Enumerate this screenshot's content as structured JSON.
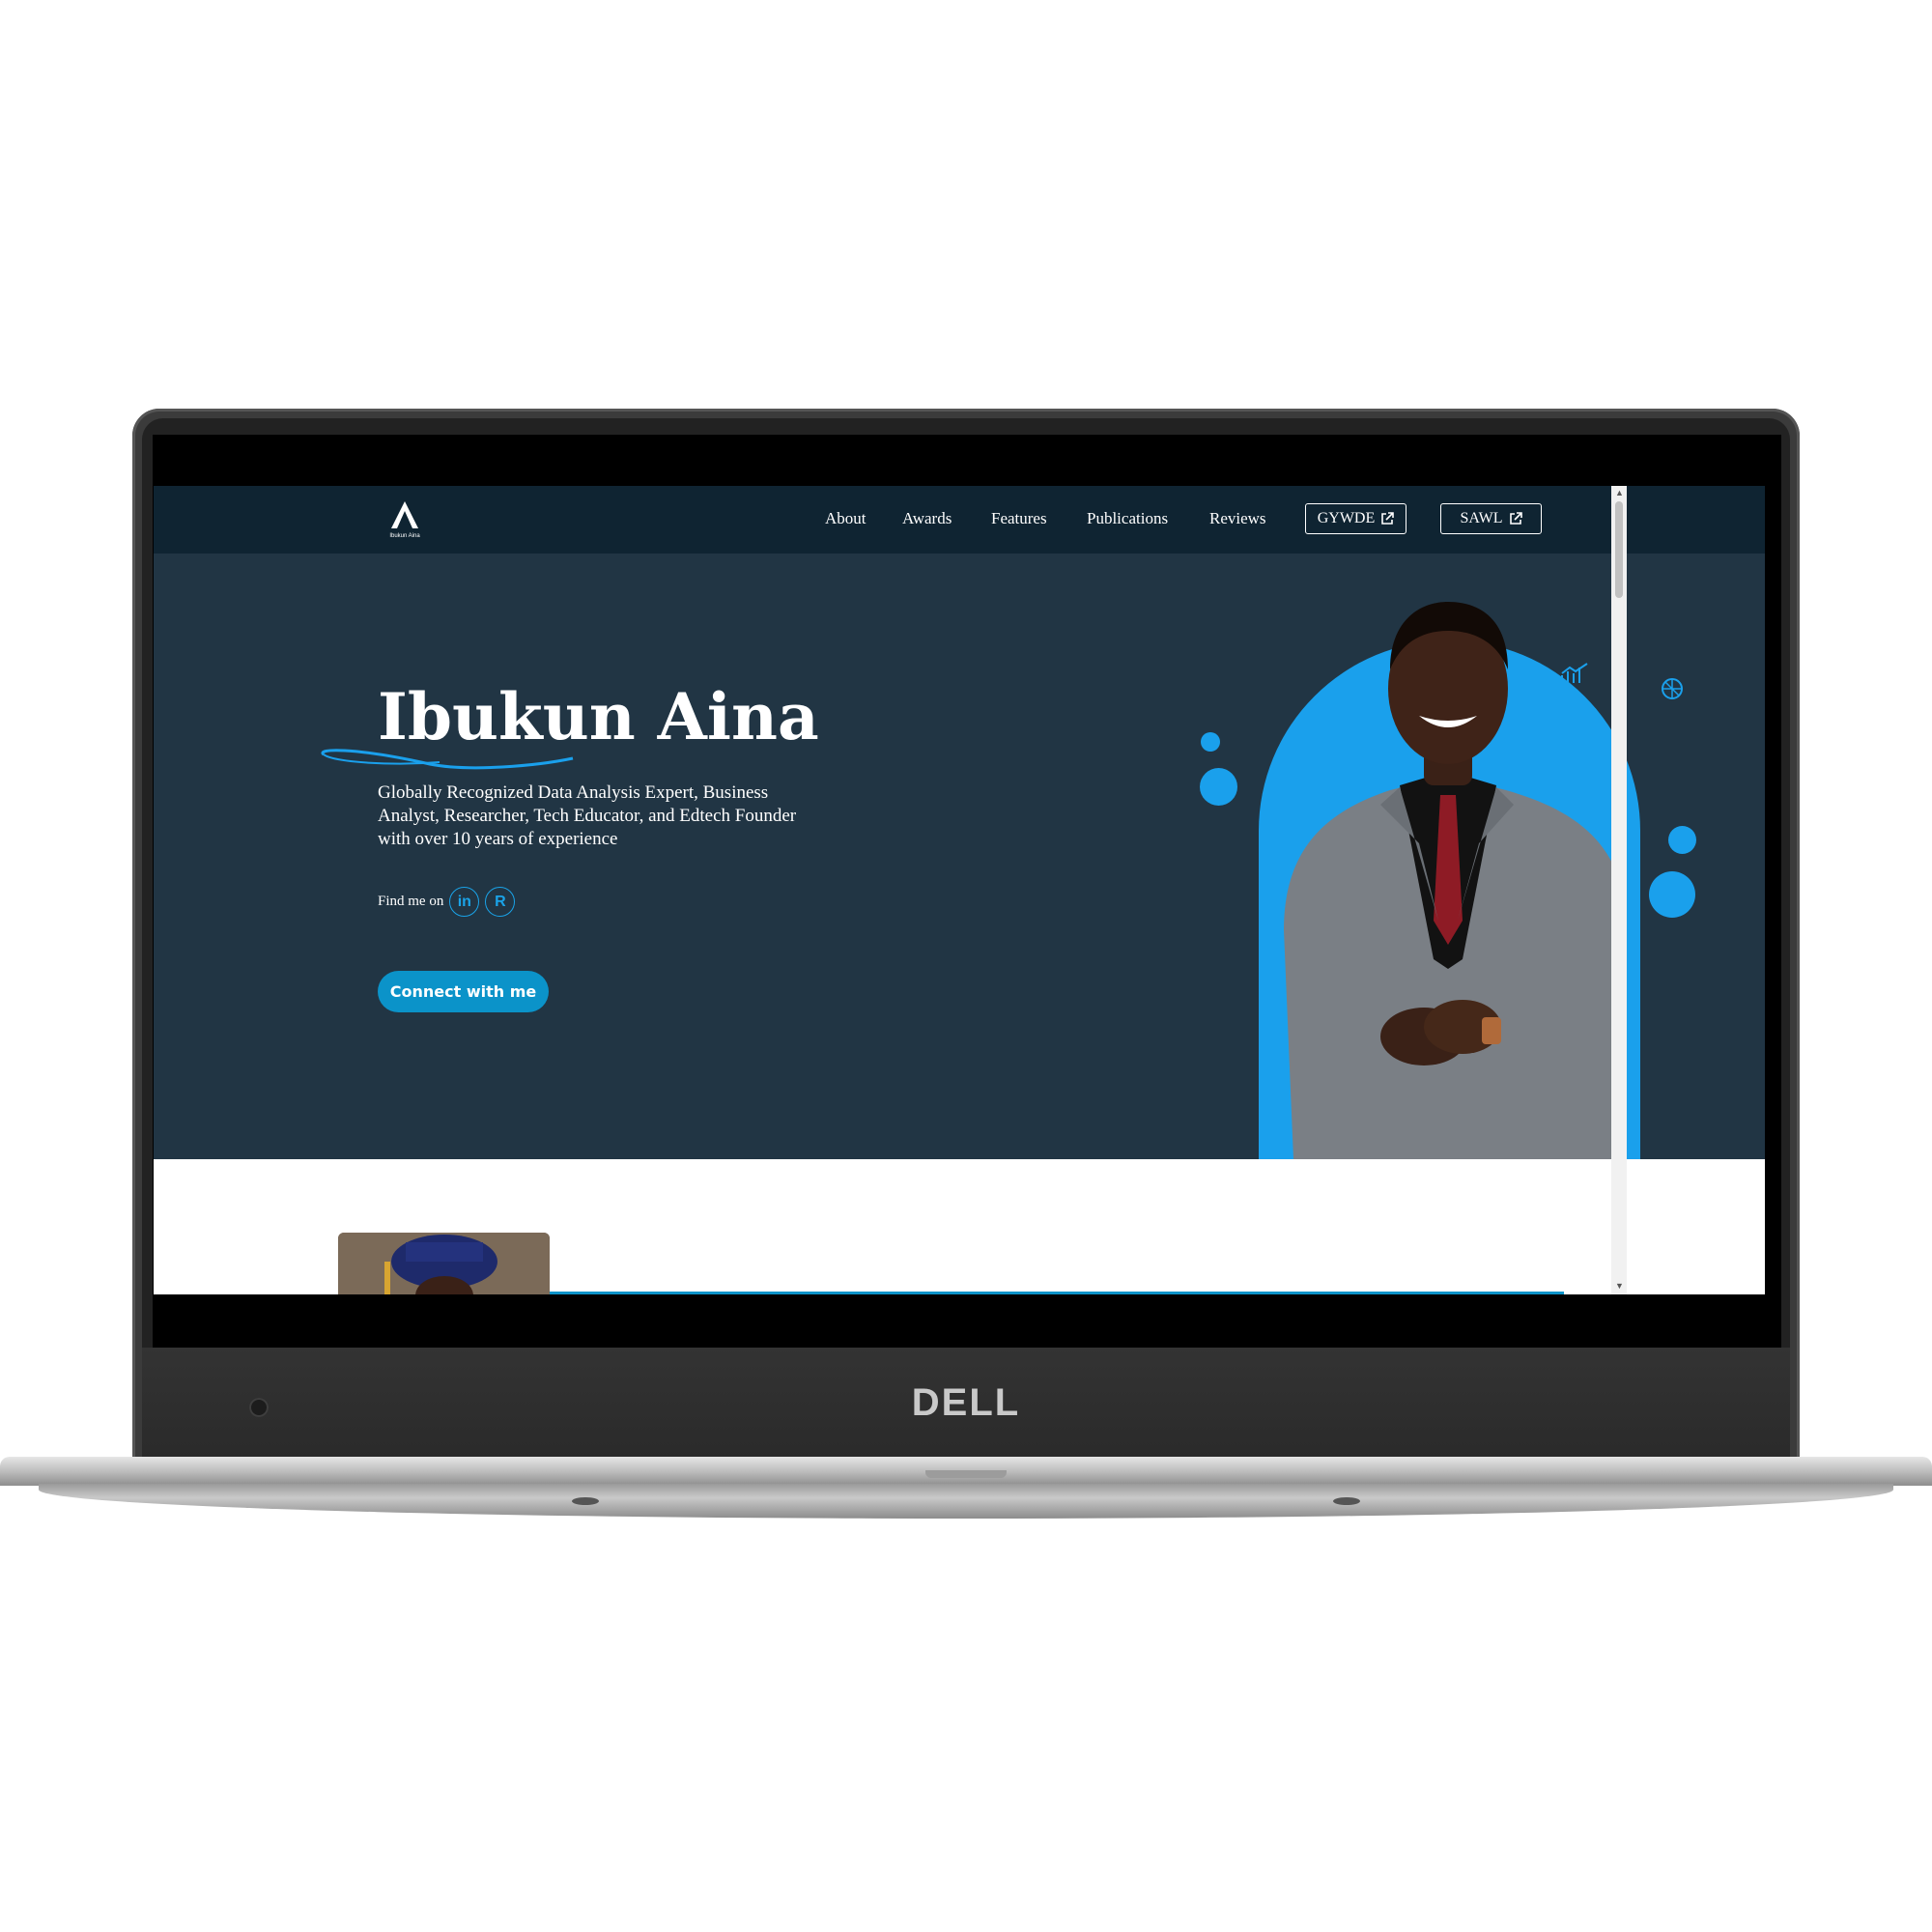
{
  "device": {
    "brand": "DELL"
  },
  "site": {
    "logo_text": "Ibukun Aina",
    "nav": {
      "links": [
        "About",
        "Awards",
        "Features",
        "Publications",
        "Reviews"
      ],
      "external_buttons": [
        "GYWDE",
        "SAWL"
      ]
    },
    "hero": {
      "name": "Ibukun Aina",
      "subtitle": "Globally Recognized Data Analysis Expert, Business Analyst, Researcher, Tech Educator, and Edtech Founder with over 10 years of experience",
      "find_me_label": "Find me on",
      "socials": [
        {
          "icon": "linkedin-icon",
          "label": "in"
        },
        {
          "icon": "researchgate-icon",
          "label": "R"
        }
      ],
      "cta_label": "Connect with me"
    }
  },
  "colors": {
    "nav_bg": "#0f2432",
    "hero_bg": "#213544",
    "accent": "#1aa0ec",
    "cta": "#0b93c9"
  }
}
